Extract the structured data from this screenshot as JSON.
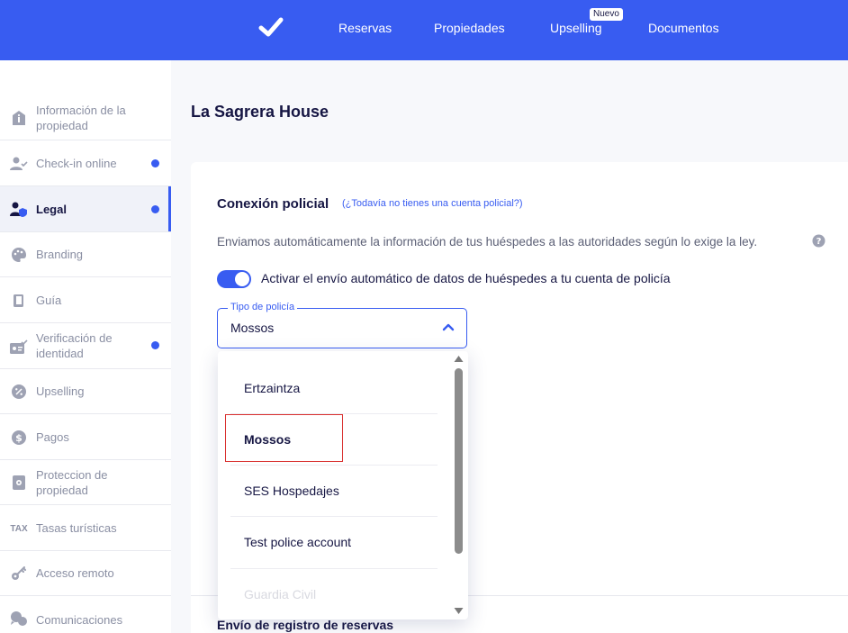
{
  "colors": {
    "primary": "#385cf1",
    "text": "#161643",
    "muted": "#8a8fa3",
    "highlight": "#d9302f"
  },
  "topbar": {
    "logo_icon": "checkmark-icon",
    "nav": [
      "Reservas",
      "Propiedades",
      "Upselling",
      "Documentos"
    ],
    "badge": "Nuevo"
  },
  "sidebar": {
    "items": [
      {
        "label": "Información de la propiedad",
        "icon": "info-house-icon",
        "dot": false
      },
      {
        "label": "Check-in online",
        "icon": "user-check-icon",
        "dot": true
      },
      {
        "label": "Legal",
        "icon": "legal-shield-icon",
        "dot": true,
        "active": true
      },
      {
        "label": "Branding",
        "icon": "palette-icon",
        "dot": false
      },
      {
        "label": "Guía",
        "icon": "book-icon",
        "dot": false
      },
      {
        "label": "Verificación de identidad",
        "icon": "id-card-check-icon",
        "dot": true
      },
      {
        "label": "Upselling",
        "icon": "percent-badge-icon",
        "dot": false
      },
      {
        "label": "Pagos",
        "icon": "dollar-icon",
        "dot": false
      },
      {
        "label": "Proteccion de propiedad",
        "icon": "property-protection-icon",
        "dot": false
      },
      {
        "label": "Tasas turísticas",
        "icon": "tax-icon",
        "icon_text": "TAX",
        "dot": false
      },
      {
        "label": "Acceso remoto",
        "icon": "key-icon",
        "dot": false
      },
      {
        "label": "Comunicaciones",
        "icon": "chat-bubbles-icon",
        "dot": false
      }
    ]
  },
  "main": {
    "title": "La Sagrera House",
    "section": {
      "title": "Conexión policial",
      "link": "(¿Todavía no tienes una cuenta policial?)",
      "description": "Enviamos automáticamente la información de tus huéspedes a las autoridades según lo exige la ley.",
      "help_icon": "question-circle-icon"
    },
    "toggle": {
      "on": true,
      "label": "Activar el envío automático de datos de huéspedes a tu cuenta de policía"
    },
    "select": {
      "legend": "Tipo de policía",
      "value": "Mossos",
      "options": [
        "Ertzaintza",
        "Mossos",
        "SES Hospedajes",
        "Test police account",
        "Guardia Civil"
      ],
      "selected_index": 1
    },
    "next_section_title": "Envío de registro de reservas"
  }
}
